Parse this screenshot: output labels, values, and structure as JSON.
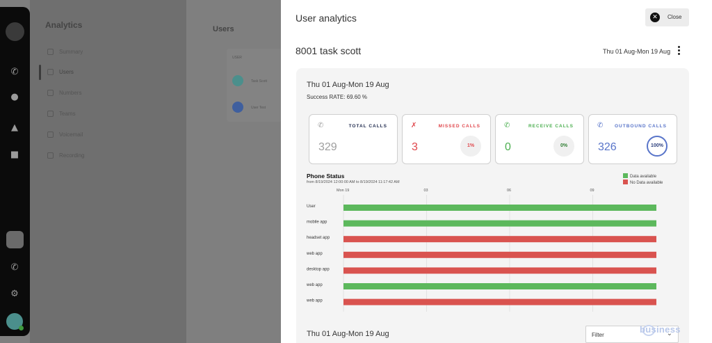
{
  "background": {
    "section_title": "Analytics",
    "nav": [
      "Summary",
      "Users",
      "Numbers",
      "Teams",
      "Voicemail",
      "Recording"
    ],
    "users_title": "Users",
    "list_header": "USER",
    "list_users": [
      "Task Scott",
      "User Test"
    ]
  },
  "drawer": {
    "title": "User analytics",
    "close_label": "Close",
    "agent_name": "8001 task scott",
    "date_range": "Thu 01 Aug-Mon 19 Aug",
    "panel": {
      "date_range": "Thu 01 Aug-Mon 19 Aug",
      "success_rate": "Success RATE: 69.60 %",
      "stats": [
        {
          "label": "TOTAL CALLS",
          "value": "329",
          "percent": "",
          "color": "#1f2a4d",
          "value_color": "#9e9e9e",
          "icon": "phone-icon"
        },
        {
          "label": "MISSED CALLS",
          "value": "3",
          "percent": "1%",
          "color": "#e0474c",
          "value_color": "#e0474c",
          "icon": "missed-call-icon"
        },
        {
          "label": "RECEIVE CALLS",
          "value": "0",
          "percent": "0%",
          "color": "#4caf50",
          "value_color": "#4caf50",
          "icon": "incoming-call-icon"
        },
        {
          "label": "OUTBOUND CALLS",
          "value": "326",
          "percent": "100%",
          "color": "#5874c9",
          "value_color": "#5874c9",
          "icon": "outgoing-call-icon"
        }
      ]
    },
    "phone_status": {
      "title": "Phone Status",
      "subtitle": "from 8/19/2024 12:00:00 AM to 8/19/2024 11:17:42 AM",
      "legend": [
        {
          "label": "Data available",
          "color": "#5cb85c"
        },
        {
          "label": "No Data available",
          "color": "#d9534f"
        }
      ]
    },
    "lower": {
      "date_range": "Thu 01 Aug-Mon 19 Aug",
      "filter_placeholder": "Filter"
    },
    "brand": "business"
  },
  "chart_data": {
    "type": "timeline",
    "x_ticks": [
      "Mon 19",
      "03",
      "06",
      "09"
    ],
    "rows": [
      {
        "label": "User",
        "status": "Data available"
      },
      {
        "label": "mobile app",
        "status": "Data available"
      },
      {
        "label": "headset app",
        "status": "No Data available"
      },
      {
        "label": "web app",
        "status": "No Data available"
      },
      {
        "label": "desktop app",
        "status": "No Data available"
      },
      {
        "label": "web app",
        "status": "Data available"
      },
      {
        "label": "web app",
        "status": "No Data available"
      }
    ],
    "colors": {
      "Data available": "#5cb85c",
      "No Data available": "#d9534f"
    }
  }
}
